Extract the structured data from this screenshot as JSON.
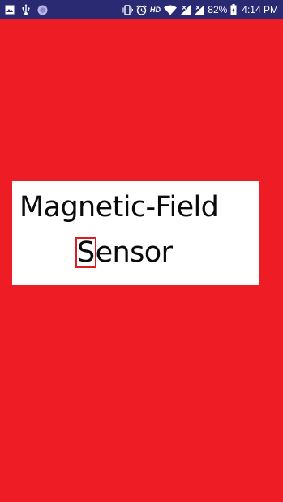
{
  "status_bar": {
    "left_icons": [
      "image-icon",
      "usb-icon",
      "circle-icon"
    ],
    "right_icons": [
      "vibrate-icon",
      "alarm-icon",
      "hd-icon",
      "wifi-icon",
      "signal-icon",
      "signal-icon",
      "battery-icon"
    ],
    "hd_label": "HD",
    "battery_percent": "82%",
    "time": "4:14 PM",
    "bg_color": "#2a2a72"
  },
  "splash": {
    "title_line1": "Magnetic-Field",
    "title_line2_first_letter": "S",
    "title_line2_rest": "ensor",
    "highlight_color": "#d81f26",
    "background_color": "#ee1c25"
  }
}
